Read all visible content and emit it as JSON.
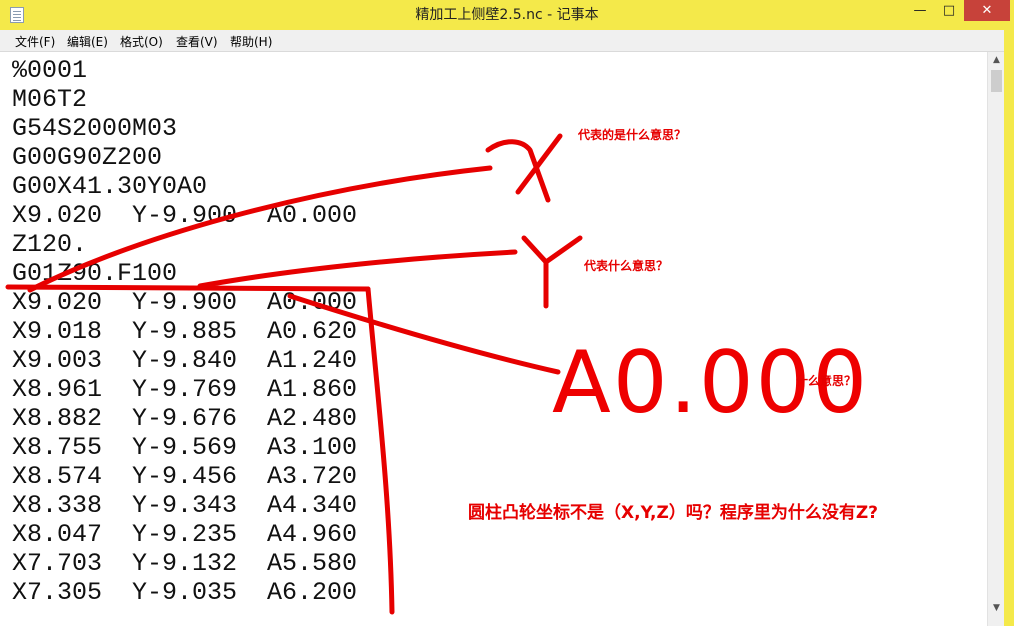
{
  "window": {
    "title": "精加工上侧壁2.5.nc - 记事本",
    "minimize_glyph": "—",
    "maximize_glyph": "□",
    "close_glyph": "✕",
    "app_icon": "notepad-icon"
  },
  "menu": {
    "items": [
      "文件(F)",
      "编辑(E)",
      "格式(O)",
      "查看(V)",
      "帮助(H)"
    ]
  },
  "editor": {
    "lines": [
      "%0001",
      "M06T2",
      "G54S2000M03",
      "G00G90Z200",
      "G00X41.30Y0A0",
      "X9.020  Y-9.900  A0.000",
      "Z120.",
      "G01Z90.F100",
      "X9.020  Y-9.900  A0.000",
      "X9.018  Y-9.885  A0.620",
      "X9.003  Y-9.840  A1.240",
      "X8.961  Y-9.769  A1.860",
      "X8.882  Y-9.676  A2.480",
      "X8.755  Y-9.569  A3.100",
      "X8.574  Y-9.456  A3.720",
      "X8.338  Y-9.343  A4.340",
      "X8.047  Y-9.235  A4.960",
      "X7.703  Y-9.132  A5.580",
      "X7.305  Y-9.035  A6.200"
    ]
  },
  "scrollbar": {
    "up_glyph": "▲",
    "down_glyph": "▼"
  },
  "annotations": {
    "x_question": "代表的是什么意思？",
    "y_question": "代表什么意思？",
    "a_question": "什么意思？",
    "big_a_text": "A0.000",
    "main_question": "圆柱凸轮坐标不是（X,Y,Z）吗？程序里为什么没有Z?",
    "ink_color": "#e60000"
  }
}
